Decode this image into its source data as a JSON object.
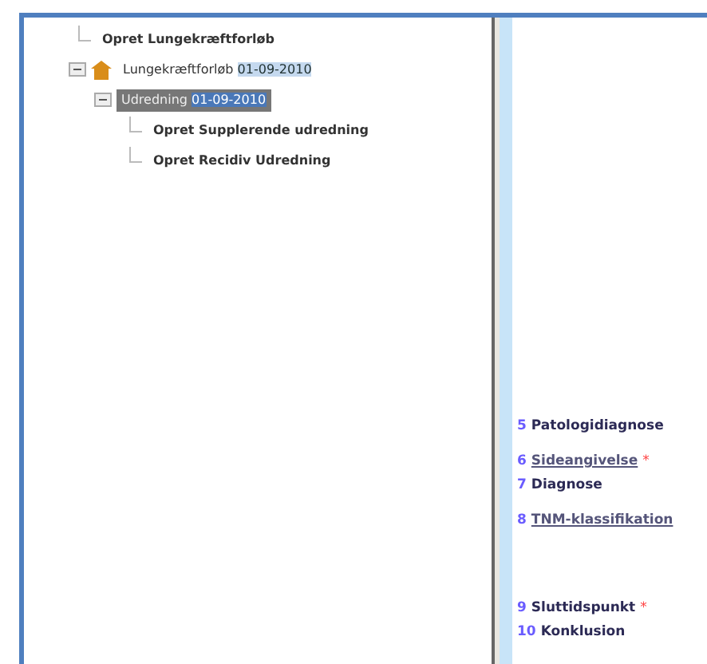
{
  "tree": [
    {
      "label": "Opret Lungekræftforløb",
      "kind": "action"
    },
    {
      "label": "Lungekræftforløb",
      "date": "01-09-2010",
      "kind": "course",
      "expanded": true,
      "selected": false,
      "children": [
        {
          "label": "Udredning",
          "date": "01-09-2010",
          "expanded": true,
          "selected": true,
          "children": [
            {
              "label": "Opret Supplerende udredning",
              "kind": "action"
            },
            {
              "label": "Opret Recidiv Udredning",
              "kind": "action"
            }
          ]
        }
      ]
    }
  ],
  "steps": [
    {
      "number": "5",
      "label": "Patologidiagnose",
      "link": false
    },
    {
      "number": "6",
      "label": "Sideangivelse",
      "link": true,
      "marker": "*"
    },
    {
      "number": "7",
      "label": "Diagnose",
      "link": false
    },
    {
      "number": "8",
      "label": "TNM-klassifikation",
      "link": true
    },
    {
      "number": "9",
      "label": "Sluttidspunkt",
      "link": false,
      "marker": "*"
    },
    {
      "number": "10",
      "label": "Konklusion",
      "link": false
    }
  ]
}
